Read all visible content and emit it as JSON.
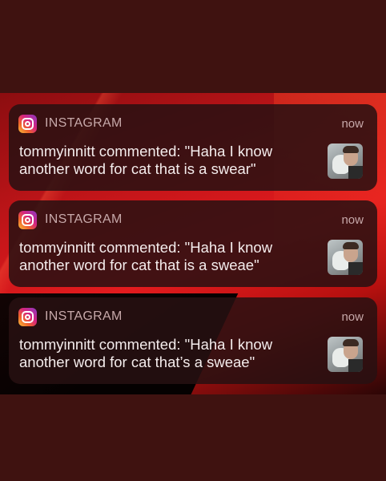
{
  "notifications": [
    {
      "app_name": "INSTAGRAM",
      "app_icon": "instagram-icon",
      "time": "now",
      "message": "tommyinnitt commented: \"Haha I know another word for cat that is a swear\""
    },
    {
      "app_name": "INSTAGRAM",
      "app_icon": "instagram-icon",
      "time": "now",
      "message": "tommyinnitt commented: \"Haha I know another word for cat that is a sweae\""
    },
    {
      "app_name": "INSTAGRAM",
      "app_icon": "instagram-icon",
      "time": "now",
      "message": "tommyinnitt commented: \"Haha I know another word for cat that’s a sweae\""
    }
  ],
  "colors": {
    "card_background": "#281012",
    "app_name_text": "#c7a9aa",
    "message_text": "#f4ecec",
    "page_background": "#3f1210"
  }
}
